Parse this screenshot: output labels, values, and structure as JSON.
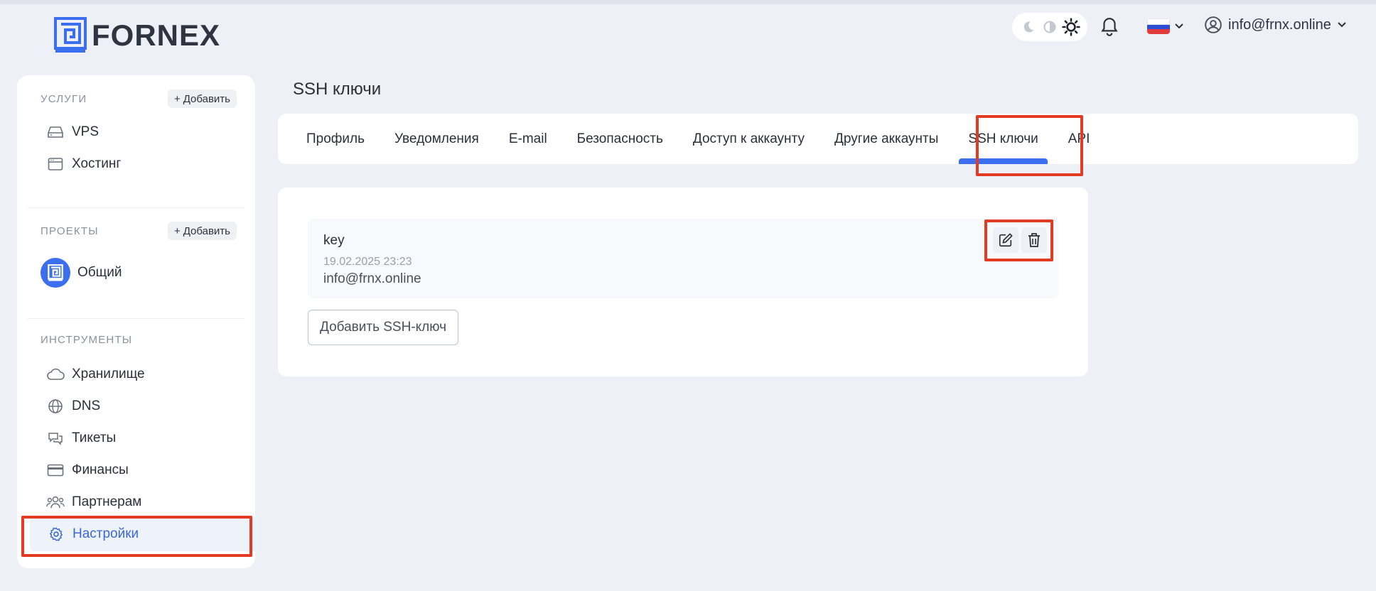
{
  "brand": {
    "name": "FORNEX",
    "color": "#3b6ff0"
  },
  "header": {
    "theme_icons": [
      "moon-icon",
      "half-moon-icon",
      "sun-icon"
    ],
    "notifications_icon": "bell-icon",
    "language_flag": "russia-flag-icon",
    "account_email": "info@frnx.online"
  },
  "sidebar": {
    "services": {
      "title": "УСЛУГИ",
      "add_label": "Добавить",
      "items": [
        {
          "label": "VPS",
          "icon": "server-icon"
        },
        {
          "label": "Хостинг",
          "icon": "browser-window-icon"
        }
      ]
    },
    "projects": {
      "title": "ПРОЕКТЫ",
      "add_label": "Добавить",
      "items": [
        {
          "label": "Общий",
          "icon": "project-avatar-icon"
        }
      ]
    },
    "tools": {
      "title": "ИНСТРУМЕНТЫ",
      "items": [
        {
          "label": "Хранилище",
          "icon": "cloud-icon"
        },
        {
          "label": "DNS",
          "icon": "globe-icon"
        },
        {
          "label": "Тикеты",
          "icon": "chat-icon"
        },
        {
          "label": "Финансы",
          "icon": "credit-card-icon"
        },
        {
          "label": "Партнерам",
          "icon": "users-icon"
        },
        {
          "label": "Настройки",
          "icon": "gear-icon",
          "active": true
        }
      ]
    }
  },
  "main": {
    "title": "SSH ключи",
    "tabs": [
      {
        "label": "Профиль"
      },
      {
        "label": "Уведомления"
      },
      {
        "label": "E-mail"
      },
      {
        "label": "Безопасность"
      },
      {
        "label": "Доступ к аккаунту"
      },
      {
        "label": "Другие аккаунты"
      },
      {
        "label": "SSH ключи",
        "active": true
      },
      {
        "label": "API"
      }
    ],
    "ssh_keys": [
      {
        "name": "key",
        "date": "19.02.2025 23:23",
        "owner": "info@frnx.online"
      }
    ],
    "add_button_label": "Добавить SSH-ключ"
  },
  "highlight_color": "#e23b22"
}
